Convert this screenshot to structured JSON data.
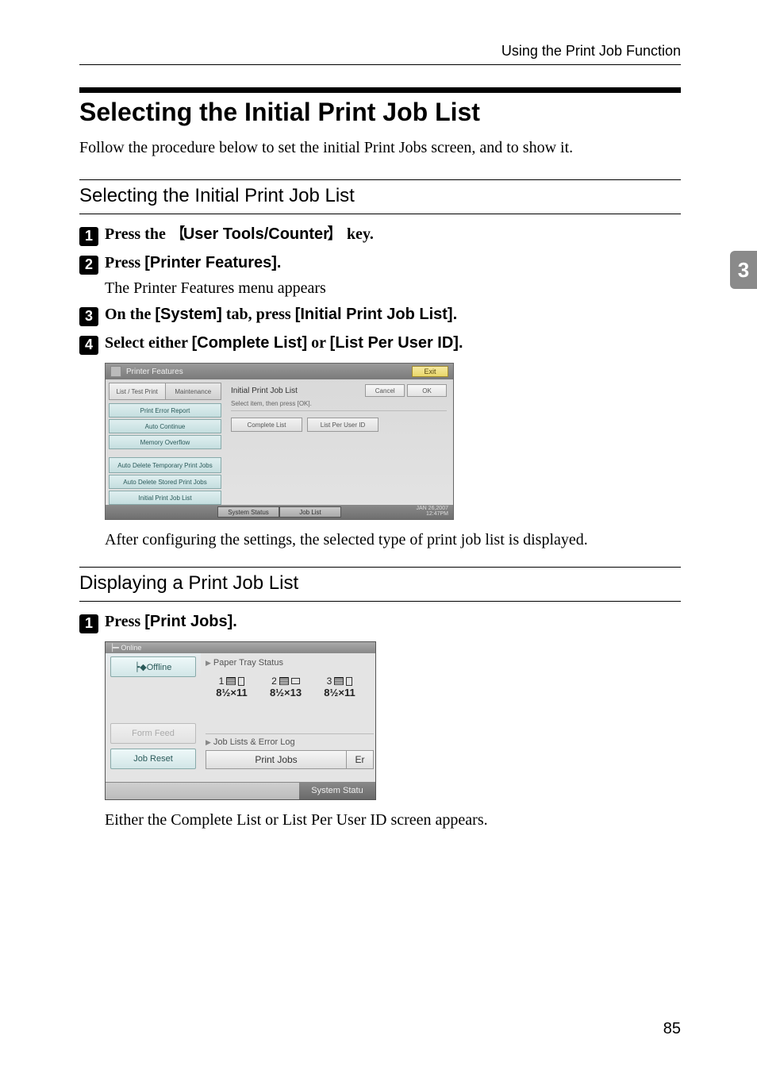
{
  "header": {
    "running": "Using the Print Job Function"
  },
  "title": "Selecting the Initial Print Job List",
  "intro": "Follow the procedure below to set the initial Print Jobs screen, and to show it.",
  "chapter": "3",
  "pageNumber": "85",
  "sections": [
    {
      "heading": "Selecting the Initial Print Job List",
      "steps": [
        {
          "num": "1",
          "parts": [
            "Press the ",
            "User Tools/Counter",
            " key."
          ]
        },
        {
          "num": "2",
          "parts": [
            "Press ",
            "[Printer Features]."
          ],
          "desc": "The Printer Features menu appears"
        },
        {
          "num": "3",
          "parts": [
            "On the ",
            "[System]",
            " tab, press ",
            "[Initial Print Job List]."
          ]
        },
        {
          "num": "4",
          "parts": [
            "Select either ",
            "[Complete List]",
            " or ",
            "[List Per User ID]."
          ]
        }
      ],
      "after": "After configuring the settings, the selected type of print job list is displayed."
    },
    {
      "heading": "Displaying a Print Job List",
      "steps": [
        {
          "num": "1",
          "parts": [
            "Press ",
            "[Print Jobs]."
          ]
        }
      ],
      "after": "Either the Complete List or List Per User ID screen appears."
    }
  ],
  "shotA": {
    "title": "Printer Features",
    "exit": "Exit",
    "tabs": [
      "List /\nTest Print",
      "Maintenance"
    ],
    "side": [
      "Print Error Report",
      "Auto Continue",
      "Memory Overflow",
      "Auto Delete Temporary Print Jobs",
      "Auto Delete Stored Print Jobs",
      "Initial Print Job List"
    ],
    "panelTitle": "Initial Print Job List",
    "cancel": "Cancel",
    "ok": "OK",
    "desc": "Select item, then press [OK].",
    "opts": [
      "Complete List",
      "List Per User ID"
    ],
    "footer": [
      "System Status",
      "Job List"
    ],
    "date": "JAN   26,2007",
    "time": "12:47PM"
  },
  "shotB": {
    "top": "┝━ Online",
    "left": [
      "┝◆Offline",
      "Form Feed",
      "Job Reset"
    ],
    "sect1": "Paper Tray Status",
    "trays": [
      {
        "num": "1",
        "size": "8½×11"
      },
      {
        "num": "2",
        "size": "8½×13"
      },
      {
        "num": "3",
        "size": "8½×11"
      }
    ],
    "sect2": "Job Lists & Error Log",
    "buttons": [
      "Print Jobs",
      "Er"
    ],
    "footer": "System Statu"
  }
}
